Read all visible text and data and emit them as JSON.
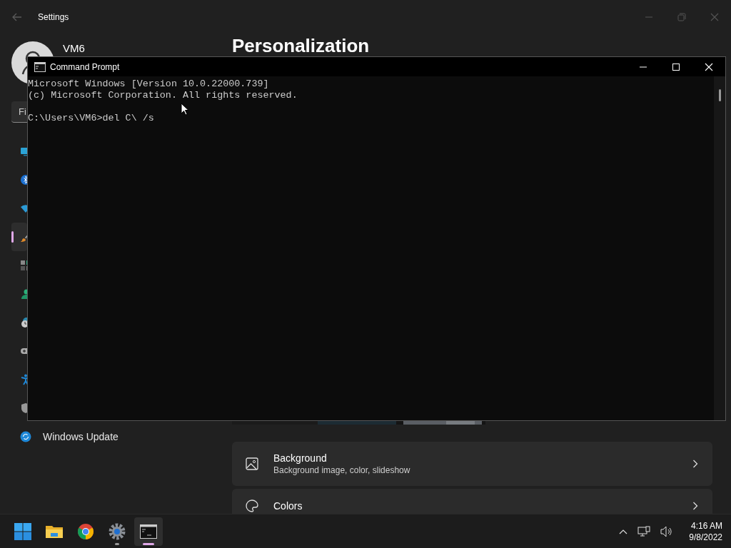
{
  "settings_window": {
    "title": "Settings",
    "profile": {
      "name": "VM6"
    },
    "search": {
      "placeholder": "Fi"
    },
    "sidebar": {
      "items": [
        {
          "kind": "system",
          "selected": false
        },
        {
          "kind": "bluetooth",
          "selected": false
        },
        {
          "kind": "network",
          "selected": false
        },
        {
          "kind": "personalization",
          "selected": true
        },
        {
          "kind": "apps",
          "selected": false
        },
        {
          "kind": "accounts",
          "selected": false
        },
        {
          "kind": "time",
          "selected": false
        },
        {
          "kind": "gaming",
          "selected": false
        },
        {
          "kind": "accessibility",
          "selected": false
        },
        {
          "kind": "privacy",
          "selected": false
        },
        {
          "kind": "update",
          "label": "Windows Update",
          "selected": false
        }
      ]
    },
    "page_title": "Personalization",
    "cards": [
      {
        "kind": "background",
        "title": "Background",
        "subtitle": "Background image, color, slideshow"
      },
      {
        "kind": "colors",
        "title": "Colors"
      }
    ]
  },
  "cmd_window": {
    "title": "Command Prompt",
    "blocks": [
      [
        "Microsoft Windows [Version 10.0.22000.739]",
        "(c) Microsoft Corporation. All rights reserved."
      ],
      [
        "C:\\Users\\VM6>del C\\ /s"
      ]
    ]
  },
  "taskbar": {
    "apps": [
      {
        "kind": "start",
        "running": false,
        "selected": false
      },
      {
        "kind": "explorer",
        "running": false,
        "selected": false
      },
      {
        "kind": "chrome",
        "running": false,
        "selected": false
      },
      {
        "kind": "settings",
        "running": true,
        "selected": false
      },
      {
        "kind": "cmd",
        "running": true,
        "selected": true
      }
    ],
    "clock": {
      "time": "4:16 AM",
      "date": "9/8/2022"
    }
  }
}
